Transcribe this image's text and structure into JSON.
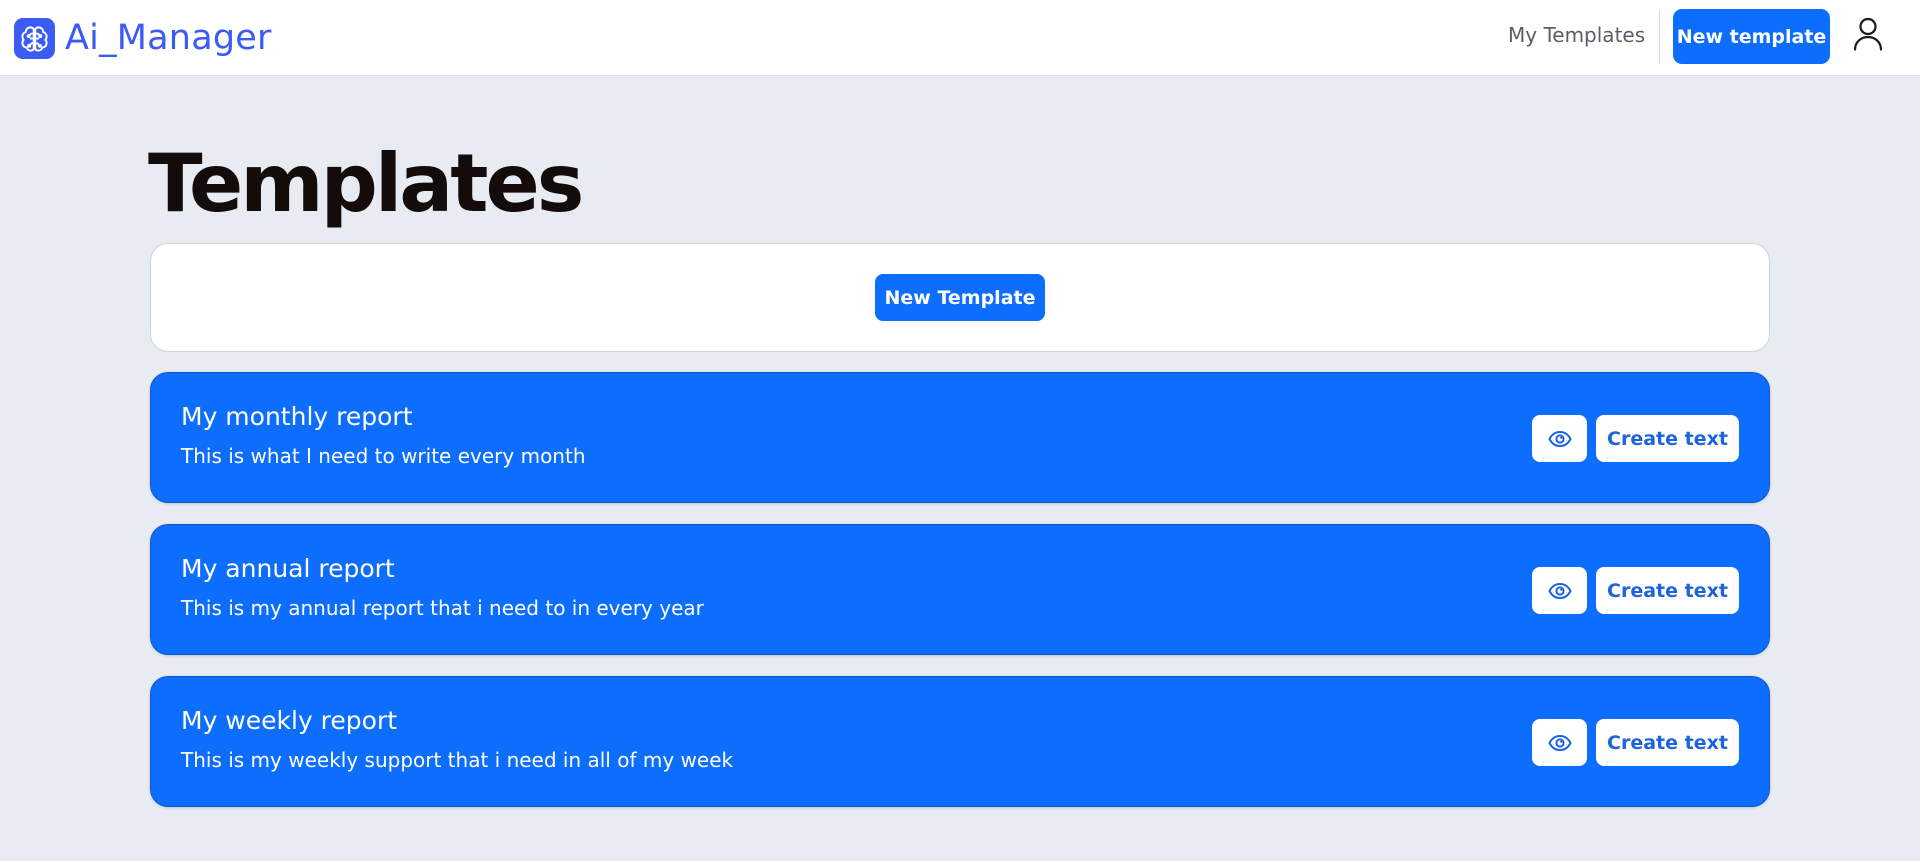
{
  "header": {
    "brand_name": "Ai_Manager",
    "brand_icon": "brain-circuit-icon",
    "nav_my_templates": "My Templates",
    "new_template_label": "New template",
    "profile_icon": "user-icon"
  },
  "main": {
    "page_title": "Templates",
    "new_template_button": "New Template",
    "templates": [
      {
        "title": "My monthly report",
        "description": "This is what I need to write every month",
        "view_icon": "eye-icon",
        "create_label": "Create text"
      },
      {
        "title": "My annual report",
        "description": "This is my annual report that i need to in every year",
        "view_icon": "eye-icon",
        "create_label": "Create text"
      },
      {
        "title": "My weekly report",
        "description": "This is my weekly support that i need in all of my week",
        "view_icon": "eye-icon",
        "create_label": "Create text"
      }
    ]
  },
  "colors": {
    "primary": "#0d6efd",
    "brand": "#3b5bf5",
    "background": "#e8ebf2",
    "surface": "#ffffff",
    "title_text": "#140b0b"
  }
}
